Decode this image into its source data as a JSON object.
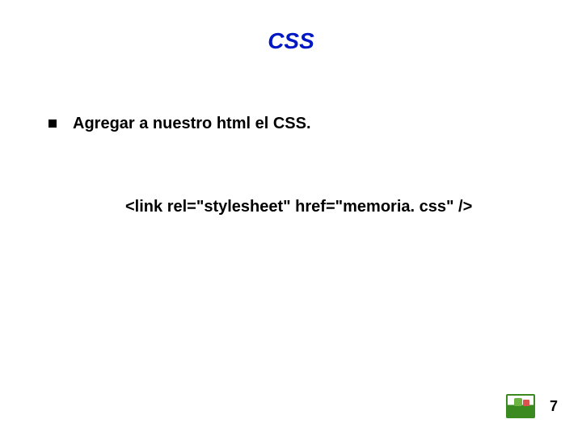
{
  "slide": {
    "title": "CSS",
    "bullet": "Agregar a nuestro html el CSS.",
    "code": "<link rel=\"stylesheet\" href=\"memoria. css\" />",
    "page_number": "7"
  }
}
